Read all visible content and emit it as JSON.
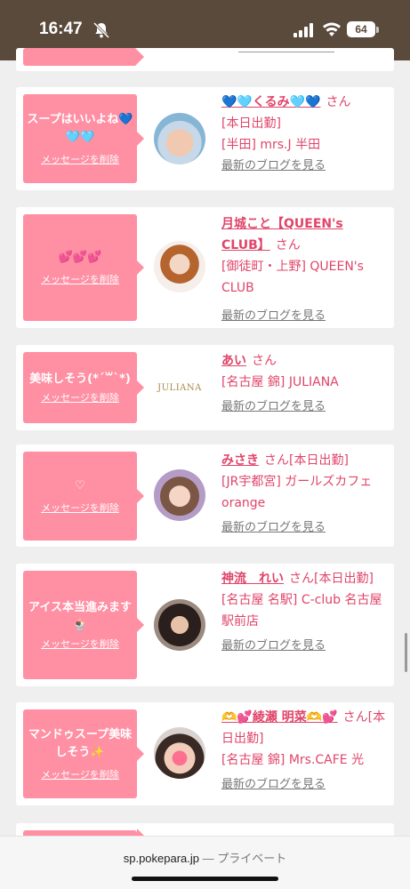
{
  "status": {
    "time": "16:47",
    "battery": "64"
  },
  "items": [
    {
      "message": "スープはいいよね💙🩵🩵",
      "delete_label": "メッセージを削除",
      "name": "💙🩵くるみ🩵💙",
      "san": "さん",
      "line2": "[本日出勤]",
      "line3": "[半田] mrs.J 半田",
      "blog": "最新のブログを見る"
    },
    {
      "message": "💕💕💕",
      "delete_label": "メッセージを削除",
      "name": "月城こと【QUEEN's CLUB】",
      "san": "さん",
      "line2": "[御徒町・上野] QUEEN's CLUB",
      "line3": "",
      "blog": "最新のブログを見る"
    },
    {
      "message": "美味しそう(*´꒳`*)",
      "delete_label": "メッセージを削除",
      "name": "あい",
      "san": "さん",
      "line2": "[名古屋 錦] JULIANA",
      "line3": "",
      "blog": "最新のブログを見る",
      "logo": "JULIANA"
    },
    {
      "message": "♡",
      "delete_label": "メッセージを削除",
      "name": "みさき",
      "san": "さん[本日出勤]",
      "line2": "[JR宇都宮] ガールズカフェ orange",
      "line3": "",
      "blog": "最新のブログを見る"
    },
    {
      "message": "アイス本当進みます🍨",
      "delete_label": "メッセージを削除",
      "name": "神流　れい",
      "san": "さん[本日出勤]",
      "line2": "[名古屋 名駅] C-club 名古屋駅前店",
      "line3": "",
      "blog": "最新のブログを見る"
    },
    {
      "message": "マンドゥスープ美味しそう✨",
      "delete_label": "メッセージを削除",
      "name": "🫶💕綾瀬 明菜🫶💕",
      "san": "さん[本日出勤]",
      "line2": "[名古屋 錦] Mrs.CAFE 光",
      "line3": "",
      "blog": "最新のブログを見る"
    }
  ],
  "browser": {
    "url": "sp.pokepara.jp",
    "mode": "— プライベート"
  },
  "colors": {
    "accent": "#e0456a",
    "bubble": "#ff8fa3",
    "statusbar": "#5a4a3b"
  }
}
